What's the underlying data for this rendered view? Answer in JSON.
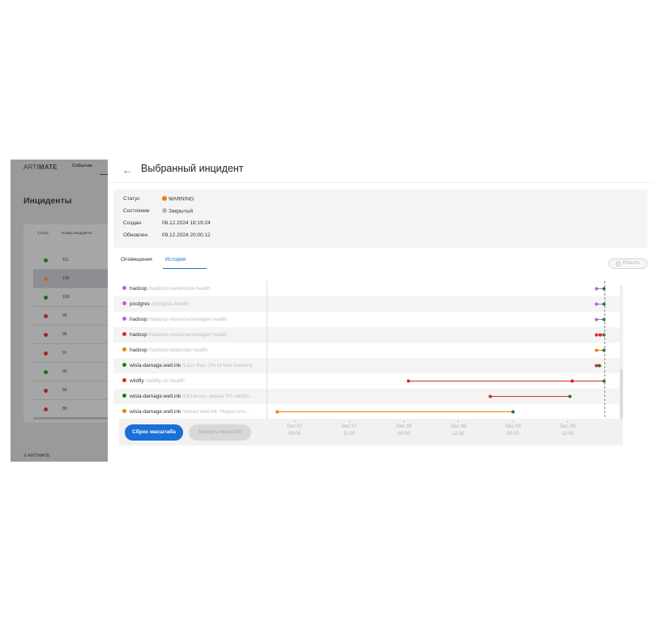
{
  "background_app": {
    "logo_light": "ARTI",
    "logo_bold": "MATE",
    "nav_tab": "События",
    "title": "Инциденты",
    "columns": [
      "Статус",
      "Номер инцидента"
    ],
    "rows": [
      {
        "number": "111",
        "status_color": "#1f6b1f",
        "selected": false
      },
      {
        "number": "108",
        "status_color": "#c46a1c",
        "selected": true
      },
      {
        "number": "109",
        "status_color": "#1f6b1f",
        "selected": false
      },
      {
        "number": "99",
        "status_color": "#a52525",
        "selected": false
      },
      {
        "number": "96",
        "status_color": "#a52525",
        "selected": false
      },
      {
        "number": "91",
        "status_color": "#a52525",
        "selected": false
      },
      {
        "number": "90",
        "status_color": "#1f6b1f",
        "selected": false
      },
      {
        "number": "89",
        "status_color": "#a52525",
        "selected": false
      },
      {
        "number": "88",
        "status_color": "#a52525",
        "selected": false
      }
    ],
    "footer": "© ARTIMATE"
  },
  "panel": {
    "back_icon": "arrow-left-icon",
    "title": "Выбранный инцидент",
    "info": [
      {
        "label": "Статус",
        "value": "WARNING",
        "dot_color": "#f07d10"
      },
      {
        "label": "Состояние",
        "value": "Закрытый",
        "dot_color": "#b8b8b8"
      },
      {
        "label": "Создан",
        "value": "06.12.2024 18:19:24",
        "dot_color": ""
      },
      {
        "label": "Обновлен",
        "value": "09.12.2024 20:00:12",
        "dot_color": ""
      }
    ],
    "tabs": [
      {
        "label": "Оповещения",
        "active": false
      },
      {
        "label": "История",
        "active": true
      }
    ],
    "resolve_button": "Решить",
    "resolve_icon": "check-circle-icon"
  },
  "colors": {
    "accent": "#1a6fd8",
    "purple": "#b266e0",
    "red": "#d62b2b",
    "orange": "#f07d10",
    "green": "#1e7a1e"
  },
  "timeline": {
    "x_min": "2024-12-06T18:00",
    "x_max": "2024-12-10T00:00",
    "now": "2024-12-09T20:00",
    "rows": [
      {
        "host": "hadoop",
        "check": "/hadoop-namenode-health",
        "dot_color": "#b266e0",
        "segments": [
          {
            "from": "2024-12-09T18:20",
            "to": "2024-12-09T20:00",
            "color": "#b266e0",
            "end_color": "#1e7a1e"
          }
        ]
      },
      {
        "host": "postgres",
        "check": "/postgres-health",
        "dot_color": "#b266e0",
        "segments": [
          {
            "from": "2024-12-09T18:20",
            "to": "2024-12-09T20:00",
            "color": "#b266e0",
            "end_color": "#1e7a1e"
          }
        ]
      },
      {
        "host": "hadoop",
        "check": "/hadoop-resourcemanager-health",
        "dot_color": "#b266e0",
        "segments": [
          {
            "from": "2024-12-09T18:20",
            "to": "2024-12-09T20:00",
            "color": "#b266e0",
            "end_color": "#1e7a1e"
          }
        ]
      },
      {
        "host": "hadoop",
        "check": "/hadoop-resourcemanager-health",
        "dot_color": "#d62b2b",
        "segments": [
          {
            "from": "2024-12-09T18:20",
            "to": "2024-12-09T19:10",
            "color": "#d62b2b",
            "end_color": "#d62b2b"
          },
          {
            "from": "2024-12-09T19:10",
            "to": "2024-12-09T20:00",
            "color": "#d62b2b",
            "end_color": "#1e7a1e"
          }
        ]
      },
      {
        "host": "hadoop",
        "check": "/hadoop-datanode-health",
        "dot_color": "#f07d10",
        "segments": [
          {
            "from": "2024-12-09T18:20",
            "to": "2024-12-09T20:00",
            "color": "#f07d10",
            "end_color": "#1e7a1e"
          }
        ]
      },
      {
        "host": "wisla-damage.well.ink",
        "check": "/Less than 2% of free memory",
        "dot_color": "#1e7a1e",
        "segments": [
          {
            "from": "2024-12-09T18:20",
            "to": "2024-12-09T19:00",
            "color": "#d62b2b",
            "end_color": "#1e7a1e"
          }
        ]
      },
      {
        "host": "wildfly",
        "check": "/wildfly-dc-health",
        "dot_color": "#d62b2b",
        "segments": [
          {
            "from": "2024-12-08T01:00",
            "to": "2024-12-09T13:00",
            "color": "#d62b2b",
            "end_color": "#d62b2b"
          },
          {
            "from": "2024-12-09T13:00",
            "to": "2024-12-09T20:00",
            "color": "#d62b2b",
            "end_color": "#1e7a1e"
          }
        ]
      },
      {
        "host": "wisla-damage.well.ink",
        "check": "/Осталось менее 5% свобо...",
        "dot_color": "#1e7a1e",
        "segments": [
          {
            "from": "2024-12-08T19:00",
            "to": "2024-12-09T12:30",
            "color": "#d62b2b",
            "end_color": "#1e7a1e"
          }
        ]
      },
      {
        "host": "wisla-damage.well.ink",
        "check": "/wisiad.well.ink: Недостато...",
        "dot_color": "#f07d10",
        "segments": [
          {
            "from": "2024-12-06T20:10",
            "to": "2024-12-09T00:00",
            "color": "#f07d10",
            "end_color": "#1e7a1e"
          }
        ]
      }
    ],
    "ticks": [
      {
        "date": "Dec 07",
        "time": "00:00",
        "at": "2024-12-07T00:00"
      },
      {
        "date": "Dec 07",
        "time": "12:00",
        "at": "2024-12-07T12:00"
      },
      {
        "date": "Dec 08",
        "time": "00:00",
        "at": "2024-12-08T00:00"
      },
      {
        "date": "Dec 08",
        "time": "12:00",
        "at": "2024-12-08T12:00"
      },
      {
        "date": "Dec 09",
        "time": "00:00",
        "at": "2024-12-09T00:00"
      },
      {
        "date": "Dec 09",
        "time": "12:00",
        "at": "2024-12-09T12:00"
      }
    ],
    "reset_button": "Сброс масштаба",
    "restore_button": "Вернуть масштаб"
  }
}
